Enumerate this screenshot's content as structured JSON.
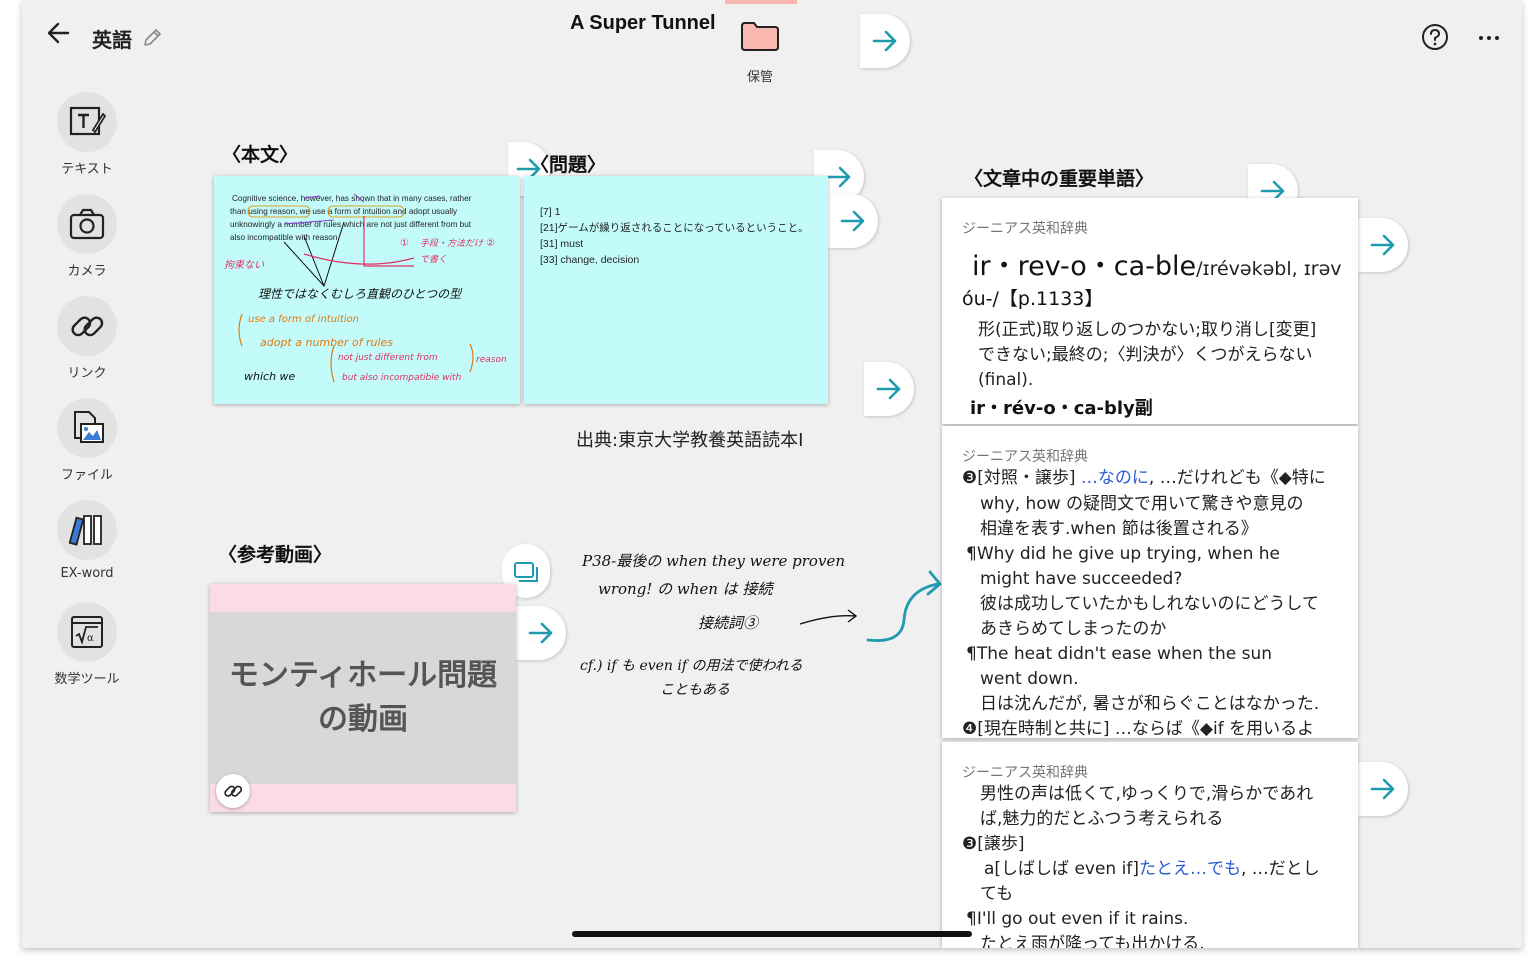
{
  "topbar": {
    "subject_title": "英語",
    "note_title": "A Super Tunnel",
    "folder_label": "保管"
  },
  "sidebar": {
    "items": [
      {
        "label": "テキスト",
        "icon": "text-tool-icon"
      },
      {
        "label": "カメラ",
        "icon": "camera-icon"
      },
      {
        "label": "リンク",
        "icon": "link-icon"
      },
      {
        "label": "ファイル",
        "icon": "file-image-icon"
      },
      {
        "label": "EX-word",
        "icon": "books-icon"
      },
      {
        "label": "数学ツール",
        "icon": "math-tool-icon"
      }
    ]
  },
  "sections": {
    "honbun": "〈本文〉",
    "mondai": "〈問題〉",
    "tango": "〈文章中の重要単語〉",
    "douga": "〈参考動画〉"
  },
  "honbun_card": {
    "printed": [
      "Cognitive science, however, has shown that in many cases, rather",
      "than using reason, we use a form of intuition and adopt usually",
      "unknowingly a number of rules which are not just different from but",
      "also incompatible with reason."
    ],
    "handwriting": [
      "拘束ない",
      "①",
      "手段・方法だけ",
      "②",
      "で書く",
      "理性ではなくむしろ直観のひとつの型",
      "use a form of intuition",
      "adopt a number of rules",
      "which we",
      "not just different from",
      "but also incompatible with",
      "reason"
    ]
  },
  "mondai_card": {
    "lines": [
      "[7] 1",
      "[21]ゲームが繰り返されることになっているということ。",
      "[31] must",
      "[33] change, decision"
    ]
  },
  "source_text": "出典:東京大学教養英語読本I",
  "video_card": {
    "title_line1": "モンティホール問題",
    "title_line2": "の動画"
  },
  "handwritten_note": {
    "lines": [
      "P38-最後の when they were proven",
      "wrong! の when は 接続",
      "接続詞③",
      "cf.) if も even if の用法で使われる",
      "こともある"
    ]
  },
  "dict_cards": [
    {
      "dict_name": "ジーニアス英和辞典",
      "headword": "ir・rev-o・ca-ble",
      "pron": "/ɪrévəkəbl, ɪrəv",
      "pron2": "óu-/【p.1133】",
      "lines": [
        "形(正式)取り返しのつかない;取り消し[変更]",
        "できない;最終の;〈判決が〉くつがえらない",
        "(final)."
      ],
      "derived": "ir・rév-o・ca-bly副"
    },
    {
      "dict_name": "ジーニアス英和辞典",
      "sense_prefix": "❸[対照・譲歩]",
      "sense_blue": "…なのに",
      "sense_rest": ", …だけれども《◆特に",
      "lines": [
        "why, how の疑問文で用いて驚きや意見の",
        "相違を表す.when 節は後置される》",
        "¶Why did he give up trying, when he",
        "might have succeeded?",
        "彼は成功していたかもしれないのにどうして",
        "あきらめてしまったのか",
        "¶The heat didn't ease when the sun",
        "went down.",
        "日は沈んだが, 暑さが和らぐことはなかった.",
        "❹[現在時制と共に] …ならば《◆if を用いるよ"
      ]
    },
    {
      "dict_name": "ジーニアス英和辞典",
      "lines_a": [
        "男性の声は低くて,ゆっくりで,滑らかであれ",
        "ば,魅力的だとふつう考えられる",
        "❸[譲歩]"
      ],
      "sense_prefix": "a[しばしば even if]",
      "sense_blue": "たとえ…でも",
      "sense_rest": ", …だとし",
      "lines_b": [
        "ても",
        "¶I'll go out even if it rains.",
        "たとえ雨が降っても出かける."
      ]
    }
  ],
  "colors": {
    "accent_arrow": "#1f9bb0",
    "cyan_card": "#c3fbfb",
    "pink_card": "#fadbe6",
    "folder": "#f8b8b0",
    "dict_blue": "#2a5ad6"
  }
}
